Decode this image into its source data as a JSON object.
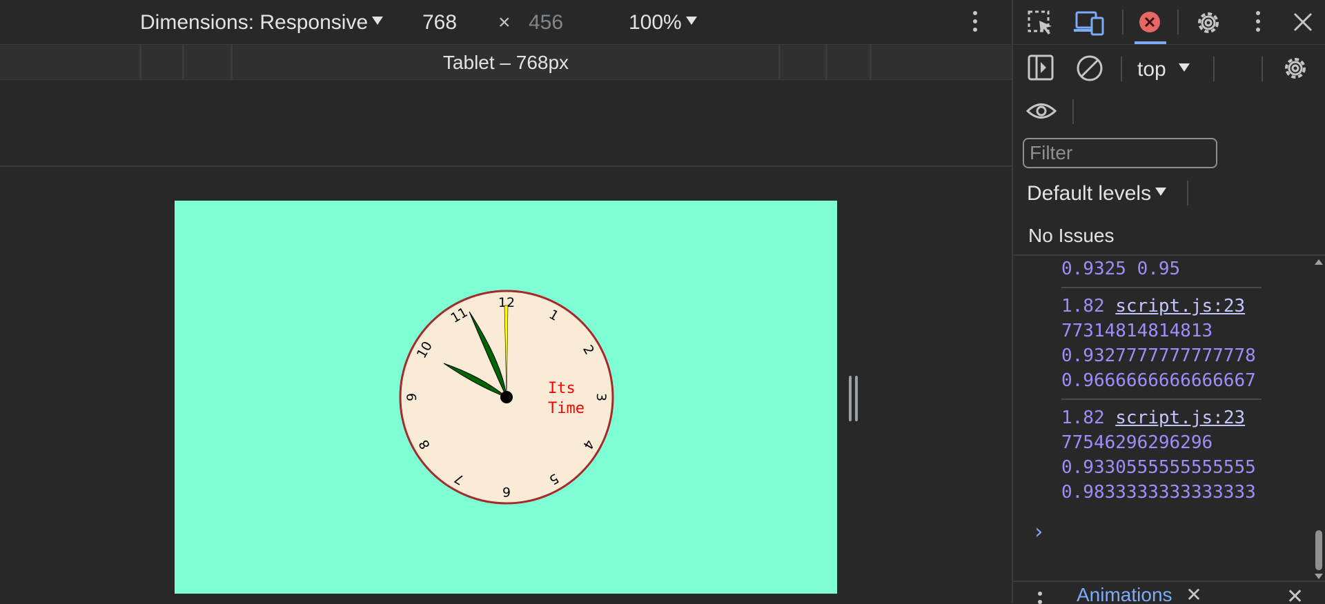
{
  "toolbar": {
    "dimensions_label": "Dimensions: Responsive",
    "width_value": "768",
    "times": "×",
    "height_value": "456",
    "zoom": "100%"
  },
  "media_query": {
    "label": "Tablet – 768px"
  },
  "clock": {
    "background": "#7fffd4",
    "face_color": "#faebd7",
    "rim_color": "#a52a2a",
    "numbers": [
      "12",
      "1",
      "2",
      "3",
      "4",
      "5",
      "6",
      "7",
      "8",
      "9",
      "10",
      "11"
    ],
    "text_line1": "Its",
    "text_line2": "Time",
    "text_color": "#ff0000",
    "hour_hand_color": "#006400",
    "minute_hand_color": "#006400",
    "second_hand_color": "#ffff00"
  },
  "devtools": {
    "context": "top",
    "filter_placeholder": "Filter",
    "levels": "Default levels",
    "issues": "No Issues",
    "log": {
      "entry1_line": "0.9325 0.95",
      "entry2_num": "1.82",
      "entry2_link": "script.js:23",
      "entry2_l2": "77314814814813",
      "entry2_l3": "0.9327777777777778",
      "entry2_l4": "0.9666666666666667",
      "entry3_num": "1.82",
      "entry3_link": "script.js:23",
      "entry3_l2": "77546296296296",
      "entry3_l3": "0.9330555555555555",
      "entry3_l4": "0.9833333333333333"
    },
    "prompt": "›",
    "drawer_tab": "Animations"
  }
}
